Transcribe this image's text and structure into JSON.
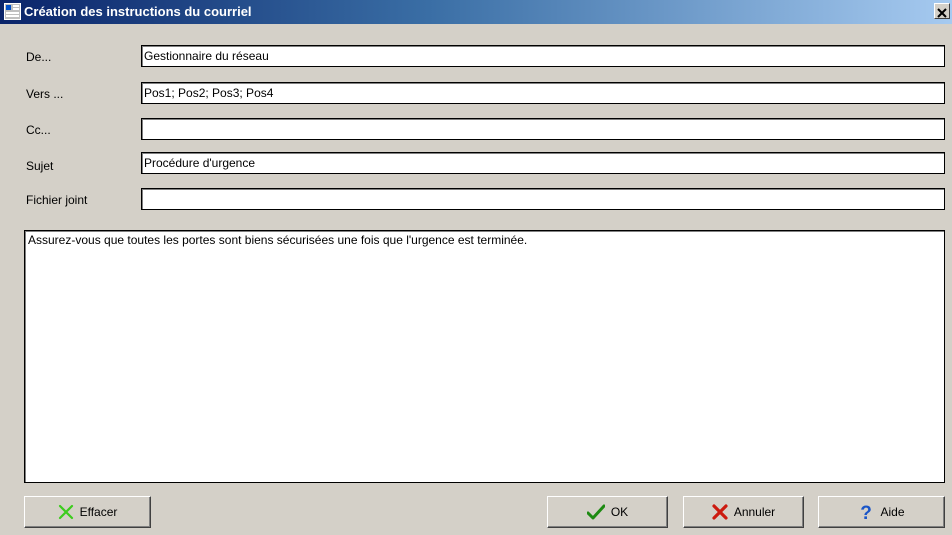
{
  "window": {
    "title": "Création des instructions du courriel"
  },
  "form": {
    "from_label": "De...",
    "from_value": "Gestionnaire du réseau",
    "to_label": "Vers ...",
    "to_value": "Pos1; Pos2; Pos3; Pos4",
    "cc_label": "Cc...",
    "cc_value": "",
    "subject_label": "Sujet",
    "subject_value": "Procédure d'urgence",
    "attachment_label": "Fichier joint",
    "attachment_value": "",
    "body": "Assurez-vous que toutes les portes sont biens sécurisées une fois que l'urgence est terminée."
  },
  "buttons": {
    "clear": "Effacer",
    "ok": "OK",
    "cancel": "Annuler",
    "help": "Aide"
  },
  "icons": {
    "clear": "green-x-icon",
    "ok": "green-check-icon",
    "cancel": "red-x-icon",
    "help": "blue-question-icon",
    "window": "app-icon",
    "close": "close-icon"
  },
  "colors": {
    "title_bar_start": "#0a246a",
    "title_bar_end": "#a6caf0",
    "dialog_bg": "#d4d0c8",
    "clear_icon": "#3ccc1e",
    "ok_icon": "#1d8a12",
    "cancel_icon": "#cc1a0f",
    "help_icon": "#1a55c8"
  }
}
